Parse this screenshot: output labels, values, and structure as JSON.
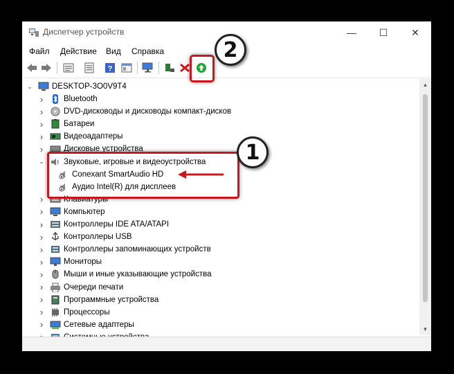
{
  "window": {
    "title": "Диспетчер устройств",
    "minimize": "—",
    "maximize": "☐",
    "close": "✕"
  },
  "menu": [
    "Файл",
    "Действие",
    "Вид",
    "Справка"
  ],
  "toolbar": [
    "back-icon",
    "forward-icon",
    "properties-icon",
    "hide-icon",
    "help-icon",
    "console-icon",
    "scan-icon",
    "update-driver-icon",
    "uninstall-icon",
    "enable-device-icon"
  ],
  "tree": {
    "root": "DESKTOP-3O0V9T4",
    "items": [
      {
        "label": "Bluetooth",
        "icon": "bluetooth-icon"
      },
      {
        "label": "DVD-дисководы и дисководы компакт-дисков",
        "icon": "dvd-icon"
      },
      {
        "label": "Батареи",
        "icon": "battery-icon"
      },
      {
        "label": "Видеоадаптеры",
        "icon": "display-adapter-icon"
      },
      {
        "label": "Дисковые устройства",
        "icon": "disk-icon"
      },
      {
        "label": "Звуковые, игровые и видеоустройства",
        "icon": "sound-icon",
        "expanded": true
      },
      {
        "label": "Conexant SmartAudio HD",
        "icon": "audio-device-icon",
        "child": true
      },
      {
        "label": "Аудио Intel(R) для дисплеев",
        "icon": "audio-device-icon",
        "child": true
      },
      {
        "label": "Клавиатуры",
        "icon": "keyboard-icon"
      },
      {
        "label": "Компьютер",
        "icon": "computer-icon"
      },
      {
        "label": "Контроллеры IDE ATA/ATAPI",
        "icon": "ide-controller-icon"
      },
      {
        "label": "Контроллеры USB",
        "icon": "usb-icon"
      },
      {
        "label": "Контроллеры запоминающих устройств",
        "icon": "storage-controller-icon"
      },
      {
        "label": "Мониторы",
        "icon": "monitor-icon"
      },
      {
        "label": "Мыши и иные указывающие устройства",
        "icon": "mouse-icon"
      },
      {
        "label": "Очереди печати",
        "icon": "printer-icon"
      },
      {
        "label": "Программные устройства",
        "icon": "software-device-icon"
      },
      {
        "label": "Процессоры",
        "icon": "processor-icon"
      },
      {
        "label": "Сетевые адаптеры",
        "icon": "network-adapter-icon"
      },
      {
        "label": "Системные устройства",
        "icon": "system-device-icon"
      }
    ]
  },
  "annotations": {
    "badge1": "1",
    "badge2": "2",
    "accent": "#c8181e"
  }
}
